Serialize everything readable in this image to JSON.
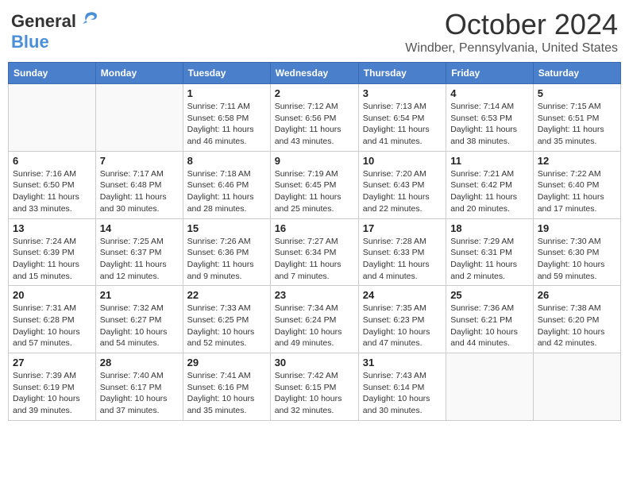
{
  "header": {
    "logo_line1": "General",
    "logo_line2": "Blue",
    "month": "October 2024",
    "location": "Windber, Pennsylvania, United States"
  },
  "days_of_week": [
    "Sunday",
    "Monday",
    "Tuesday",
    "Wednesday",
    "Thursday",
    "Friday",
    "Saturday"
  ],
  "weeks": [
    [
      {
        "day": "",
        "info": ""
      },
      {
        "day": "",
        "info": ""
      },
      {
        "day": "1",
        "info": "Sunrise: 7:11 AM\nSunset: 6:58 PM\nDaylight: 11 hours and 46 minutes."
      },
      {
        "day": "2",
        "info": "Sunrise: 7:12 AM\nSunset: 6:56 PM\nDaylight: 11 hours and 43 minutes."
      },
      {
        "day": "3",
        "info": "Sunrise: 7:13 AM\nSunset: 6:54 PM\nDaylight: 11 hours and 41 minutes."
      },
      {
        "day": "4",
        "info": "Sunrise: 7:14 AM\nSunset: 6:53 PM\nDaylight: 11 hours and 38 minutes."
      },
      {
        "day": "5",
        "info": "Sunrise: 7:15 AM\nSunset: 6:51 PM\nDaylight: 11 hours and 35 minutes."
      }
    ],
    [
      {
        "day": "6",
        "info": "Sunrise: 7:16 AM\nSunset: 6:50 PM\nDaylight: 11 hours and 33 minutes."
      },
      {
        "day": "7",
        "info": "Sunrise: 7:17 AM\nSunset: 6:48 PM\nDaylight: 11 hours and 30 minutes."
      },
      {
        "day": "8",
        "info": "Sunrise: 7:18 AM\nSunset: 6:46 PM\nDaylight: 11 hours and 28 minutes."
      },
      {
        "day": "9",
        "info": "Sunrise: 7:19 AM\nSunset: 6:45 PM\nDaylight: 11 hours and 25 minutes."
      },
      {
        "day": "10",
        "info": "Sunrise: 7:20 AM\nSunset: 6:43 PM\nDaylight: 11 hours and 22 minutes."
      },
      {
        "day": "11",
        "info": "Sunrise: 7:21 AM\nSunset: 6:42 PM\nDaylight: 11 hours and 20 minutes."
      },
      {
        "day": "12",
        "info": "Sunrise: 7:22 AM\nSunset: 6:40 PM\nDaylight: 11 hours and 17 minutes."
      }
    ],
    [
      {
        "day": "13",
        "info": "Sunrise: 7:24 AM\nSunset: 6:39 PM\nDaylight: 11 hours and 15 minutes."
      },
      {
        "day": "14",
        "info": "Sunrise: 7:25 AM\nSunset: 6:37 PM\nDaylight: 11 hours and 12 minutes."
      },
      {
        "day": "15",
        "info": "Sunrise: 7:26 AM\nSunset: 6:36 PM\nDaylight: 11 hours and 9 minutes."
      },
      {
        "day": "16",
        "info": "Sunrise: 7:27 AM\nSunset: 6:34 PM\nDaylight: 11 hours and 7 minutes."
      },
      {
        "day": "17",
        "info": "Sunrise: 7:28 AM\nSunset: 6:33 PM\nDaylight: 11 hours and 4 minutes."
      },
      {
        "day": "18",
        "info": "Sunrise: 7:29 AM\nSunset: 6:31 PM\nDaylight: 11 hours and 2 minutes."
      },
      {
        "day": "19",
        "info": "Sunrise: 7:30 AM\nSunset: 6:30 PM\nDaylight: 10 hours and 59 minutes."
      }
    ],
    [
      {
        "day": "20",
        "info": "Sunrise: 7:31 AM\nSunset: 6:28 PM\nDaylight: 10 hours and 57 minutes."
      },
      {
        "day": "21",
        "info": "Sunrise: 7:32 AM\nSunset: 6:27 PM\nDaylight: 10 hours and 54 minutes."
      },
      {
        "day": "22",
        "info": "Sunrise: 7:33 AM\nSunset: 6:25 PM\nDaylight: 10 hours and 52 minutes."
      },
      {
        "day": "23",
        "info": "Sunrise: 7:34 AM\nSunset: 6:24 PM\nDaylight: 10 hours and 49 minutes."
      },
      {
        "day": "24",
        "info": "Sunrise: 7:35 AM\nSunset: 6:23 PM\nDaylight: 10 hours and 47 minutes."
      },
      {
        "day": "25",
        "info": "Sunrise: 7:36 AM\nSunset: 6:21 PM\nDaylight: 10 hours and 44 minutes."
      },
      {
        "day": "26",
        "info": "Sunrise: 7:38 AM\nSunset: 6:20 PM\nDaylight: 10 hours and 42 minutes."
      }
    ],
    [
      {
        "day": "27",
        "info": "Sunrise: 7:39 AM\nSunset: 6:19 PM\nDaylight: 10 hours and 39 minutes."
      },
      {
        "day": "28",
        "info": "Sunrise: 7:40 AM\nSunset: 6:17 PM\nDaylight: 10 hours and 37 minutes."
      },
      {
        "day": "29",
        "info": "Sunrise: 7:41 AM\nSunset: 6:16 PM\nDaylight: 10 hours and 35 minutes."
      },
      {
        "day": "30",
        "info": "Sunrise: 7:42 AM\nSunset: 6:15 PM\nDaylight: 10 hours and 32 minutes."
      },
      {
        "day": "31",
        "info": "Sunrise: 7:43 AM\nSunset: 6:14 PM\nDaylight: 10 hours and 30 minutes."
      },
      {
        "day": "",
        "info": ""
      },
      {
        "day": "",
        "info": ""
      }
    ]
  ]
}
